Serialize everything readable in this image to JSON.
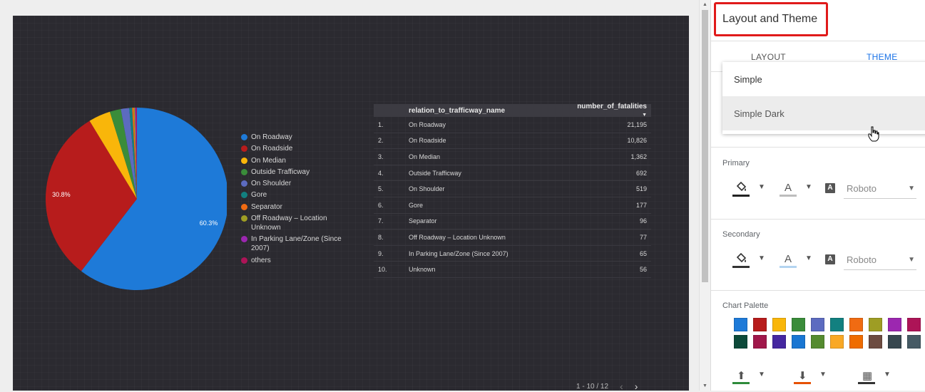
{
  "chart_data": [
    {
      "type": "pie",
      "series": [
        {
          "name": "On Roadway",
          "value": 21195,
          "color": "#1e7ad8"
        },
        {
          "name": "On Roadside",
          "value": 10826,
          "color": "#b71c1c"
        },
        {
          "name": "On Median",
          "value": 1362,
          "color": "#f9b60a"
        },
        {
          "name": "Outside Trafficway",
          "value": 692,
          "color": "#3a8c3a"
        },
        {
          "name": "On Shoulder",
          "value": 519,
          "color": "#5c6bc0"
        },
        {
          "name": "Gore",
          "value": 177,
          "color": "#128080"
        },
        {
          "name": "Separator",
          "value": 96,
          "color": "#f06b12"
        },
        {
          "name": "Off Roadway – Location Unknown",
          "value": 77,
          "color": "#9e9d24"
        },
        {
          "name": "In Parking Lane/Zone (Since 2007)",
          "value": 65,
          "color": "#9c27b0"
        },
        {
          "name": "others",
          "value": 56,
          "color": "#ad1457"
        }
      ],
      "data_labels": [
        "60.3%",
        "30.8%"
      ]
    },
    {
      "type": "table",
      "columns": [
        "relation_to_trafficway_name",
        "number_of_fatalities"
      ],
      "rows": [
        {
          "idx": "1.",
          "name": "On Roadway",
          "value": "21,195"
        },
        {
          "idx": "2.",
          "name": "On Roadside",
          "value": "10,826"
        },
        {
          "idx": "3.",
          "name": "On Median",
          "value": "1,362"
        },
        {
          "idx": "4.",
          "name": "Outside Trafficway",
          "value": "692"
        },
        {
          "idx": "5.",
          "name": "On Shoulder",
          "value": "519"
        },
        {
          "idx": "6.",
          "name": "Gore",
          "value": "177"
        },
        {
          "idx": "7.",
          "name": "Separator",
          "value": "96"
        },
        {
          "idx": "8.",
          "name": "Off Roadway – Location Unknown",
          "value": "77"
        },
        {
          "idx": "9.",
          "name": "In Parking Lane/Zone (Since 2007)",
          "value": "65"
        },
        {
          "idx": "10.",
          "name": "Unknown",
          "value": "56"
        }
      ],
      "sort_icon": "caret-down-icon"
    }
  ],
  "table": {
    "pager": "1 - 10 / 12",
    "prev_icon": "‹",
    "next_icon": "›"
  },
  "panel": {
    "title": "Layout and Theme",
    "tabs": {
      "layout": "LAYOUT",
      "theme": "THEME"
    },
    "theme_options": [
      "Simple",
      "Simple Dark"
    ],
    "hovered_option": "Simple Dark",
    "primary": {
      "label": "Primary",
      "font": "Roboto",
      "fill_color": "#222222",
      "text_color": "#bdbdbd"
    },
    "secondary": {
      "label": "Secondary",
      "font": "Roboto",
      "fill_color": "#333333",
      "text_color": "#b3d4f0"
    },
    "palette_label": "Chart Palette",
    "palette": [
      "#1e7ad8",
      "#b71c1c",
      "#f9b60a",
      "#3a8c3a",
      "#5c6bc0",
      "#128080",
      "#f06b12",
      "#9e9d24",
      "#9c27b0",
      "#ad1457",
      "#0d4a3a",
      "#a0174a",
      "#4527a0",
      "#1976d2",
      "#558b2f",
      "#f9a825",
      "#ef6c00",
      "#6d4c41",
      "#37474f",
      "#455a64"
    ],
    "bottom_tools": {
      "upload_color": "#2e8b3a",
      "download_color": "#e65100",
      "grid_color": "#333333"
    }
  },
  "icons": {
    "fill": "paint-bucket-icon",
    "text": "text-color-icon",
    "font": "font-icon",
    "upload": "upload-icon",
    "download": "download-icon",
    "grid": "grid-icon",
    "cursor": "hand-cursor-icon"
  }
}
